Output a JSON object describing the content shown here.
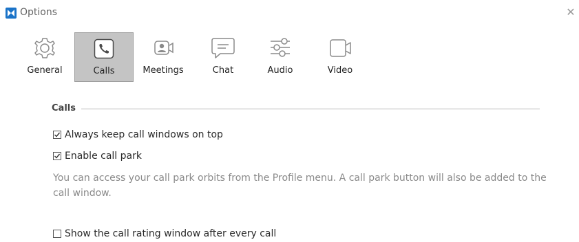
{
  "window": {
    "title": "Options",
    "close_symbol": "✕"
  },
  "tabs": [
    {
      "label": "General",
      "icon": "gear-icon",
      "active": false
    },
    {
      "label": "Calls",
      "icon": "phone-icon",
      "active": true
    },
    {
      "label": "Meetings",
      "icon": "video-camera-person-icon",
      "active": false
    },
    {
      "label": "Chat",
      "icon": "chat-bubble-icon",
      "active": false
    },
    {
      "label": "Audio",
      "icon": "sliders-icon",
      "active": false
    },
    {
      "label": "Video",
      "icon": "camera-icon",
      "active": false
    }
  ],
  "section": {
    "title": "Calls"
  },
  "options": {
    "keep_on_top": {
      "label": "Always keep call windows on top",
      "checked": true
    },
    "call_park": {
      "label": "Enable call park",
      "checked": true
    },
    "call_park_note": "You can access your call park orbits from the Profile menu. A call park button will also be added to the call window.",
    "rating_window": {
      "label": "Show the call rating window after every call",
      "checked": false
    }
  },
  "colors": {
    "active_tab_bg": "#c4c4c4",
    "brand_blue": "#1a73c8"
  }
}
